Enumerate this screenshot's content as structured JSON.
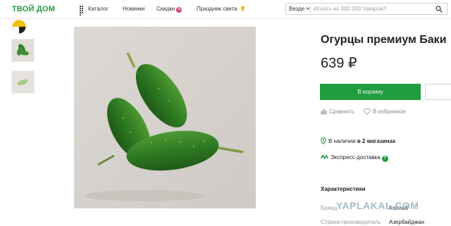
{
  "header": {
    "logo": "ТВОЙ ДОМ",
    "nav": {
      "catalog": "Каталог",
      "new": "Новинки",
      "sale": "Скидки",
      "sale_badge": "%",
      "holiday": "Праздник света"
    },
    "search": {
      "scope": "Везде",
      "placeholder": "Искать из 300 000 товаров?"
    }
  },
  "gallery": {
    "thumbnails": [
      "thumb-logo",
      "thumb-cucumbers",
      "thumb-cucumber-single"
    ]
  },
  "product": {
    "title": "Огурцы премиум Баки",
    "price": "639 ₽",
    "cart_button": "В корзину",
    "compare": "Сравнить",
    "favorite": "В избранное",
    "stock_prefix": "В наличии",
    "stock_count": "в 2 магазинах",
    "express": "Экспресс-доставка",
    "express_badge": "?"
  },
  "characteristics": {
    "title": "Характеристики",
    "rows": [
      {
        "key": "Бренд",
        "value": "Коллаб"
      },
      {
        "key": "Страна-производитель",
        "value": "Азербайджан"
      }
    ]
  },
  "watermark": "YAPLAKAL.COM",
  "colors": {
    "brand_green": "#1f9d3f",
    "sale_pink": "#d6336c",
    "holiday_yellow": "#f2c200"
  }
}
